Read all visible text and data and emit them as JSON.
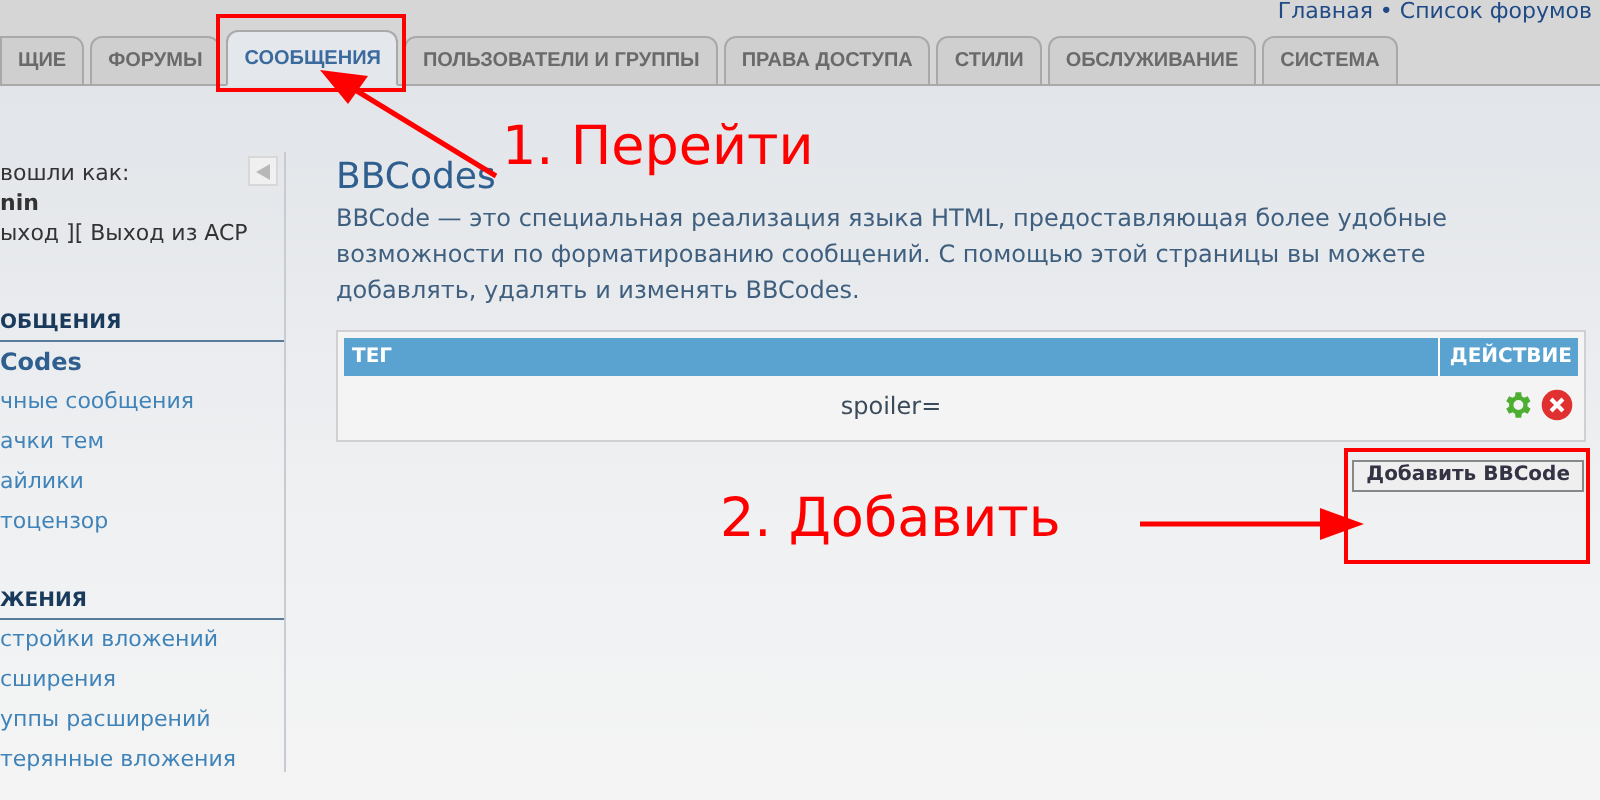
{
  "top_links": "Главная • Список форумов",
  "tabs": [
    {
      "label": "ЩИЕ",
      "selected": false
    },
    {
      "label": "ФОРУМЫ",
      "selected": false
    },
    {
      "label": "СООБЩЕНИЯ",
      "selected": true
    },
    {
      "label": "ПОЛЬЗОВАТЕЛИ И ГРУППЫ",
      "selected": false
    },
    {
      "label": "ПРАВА ДОСТУПА",
      "selected": false
    },
    {
      "label": "СТИЛИ",
      "selected": false
    },
    {
      "label": "ОБСЛУЖИВАНИЕ",
      "selected": false
    },
    {
      "label": "СИСТЕМА",
      "selected": false
    }
  ],
  "sidebar": {
    "logged_in_label": "вошли как:",
    "username": "nin",
    "logout_links": "ыход ][ Выход из ACP",
    "sections": [
      {
        "title": "ОБЩЕНИЯ",
        "items": [
          {
            "label": "Codes",
            "selected": true
          },
          {
            "label": "чные сообщения",
            "selected": false
          },
          {
            "label": "ачки тем",
            "selected": false
          },
          {
            "label": "айлики",
            "selected": false
          },
          {
            "label": "тоцензор",
            "selected": false
          }
        ]
      },
      {
        "title": "ЖЕНИЯ",
        "items": [
          {
            "label": "стройки вложений",
            "selected": false
          },
          {
            "label": "сширения",
            "selected": false
          },
          {
            "label": "уппы расширений",
            "selected": false
          },
          {
            "label": "терянные вложения",
            "selected": false
          }
        ]
      }
    ]
  },
  "page": {
    "title": "BBCodes",
    "description": "BBCode — это специальная реализация языка HTML, предоставляющая более удобные возможности по форматированию сообщений. С помощью этой страницы вы можете добавлять, удалять и изменять BBCodes."
  },
  "table": {
    "columns": [
      "ТЕГ",
      "ДЕЙСТВИЕ"
    ],
    "rows": [
      {
        "tag": "spoiler="
      }
    ]
  },
  "add_button": "Добавить BBCode",
  "annotations": [
    {
      "text": "1. Перейти"
    },
    {
      "text": "2. Добавить"
    }
  ]
}
